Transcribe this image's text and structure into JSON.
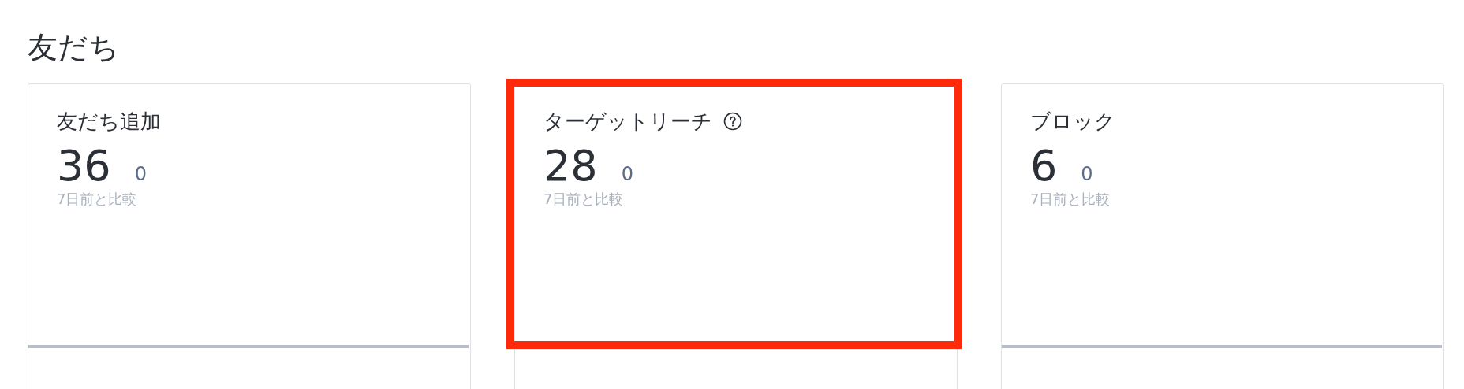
{
  "section_title": "友だち",
  "cards": [
    {
      "label": "友だち追加",
      "help_icon": false,
      "value": "36",
      "change": "0",
      "comparison": "7日前と比較",
      "highlighted": false
    },
    {
      "label": "ターゲットリーチ",
      "help_icon": true,
      "value": "28",
      "change": "0",
      "comparison": "7日前と比較",
      "highlighted": true
    },
    {
      "label": "ブロック",
      "help_icon": false,
      "value": "6",
      "change": "0",
      "comparison": "7日前と比較",
      "highlighted": false
    }
  ]
}
